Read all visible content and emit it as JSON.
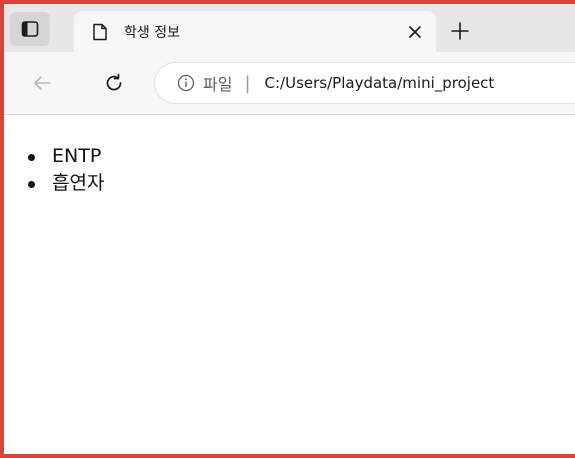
{
  "browser": {
    "tab": {
      "title": "학생 정보",
      "close_glyph": "✕"
    },
    "address": {
      "scheme_label": "파일",
      "separator": "|",
      "url": "C:/Users/Playdata/mini_project"
    },
    "icons": {
      "tab_actions": "tab-actions-icon",
      "file": "file-icon",
      "close": "close-icon",
      "new_tab": "plus-icon",
      "back": "back-arrow-icon",
      "refresh": "refresh-icon",
      "info": "info-icon"
    }
  },
  "page": {
    "items": [
      "ENTP",
      "흡연자"
    ]
  },
  "colors": {
    "frame_border": "#d9433a",
    "tabstrip_bg": "#e7e7e7",
    "toolbar_bg": "#f7f7f7"
  }
}
